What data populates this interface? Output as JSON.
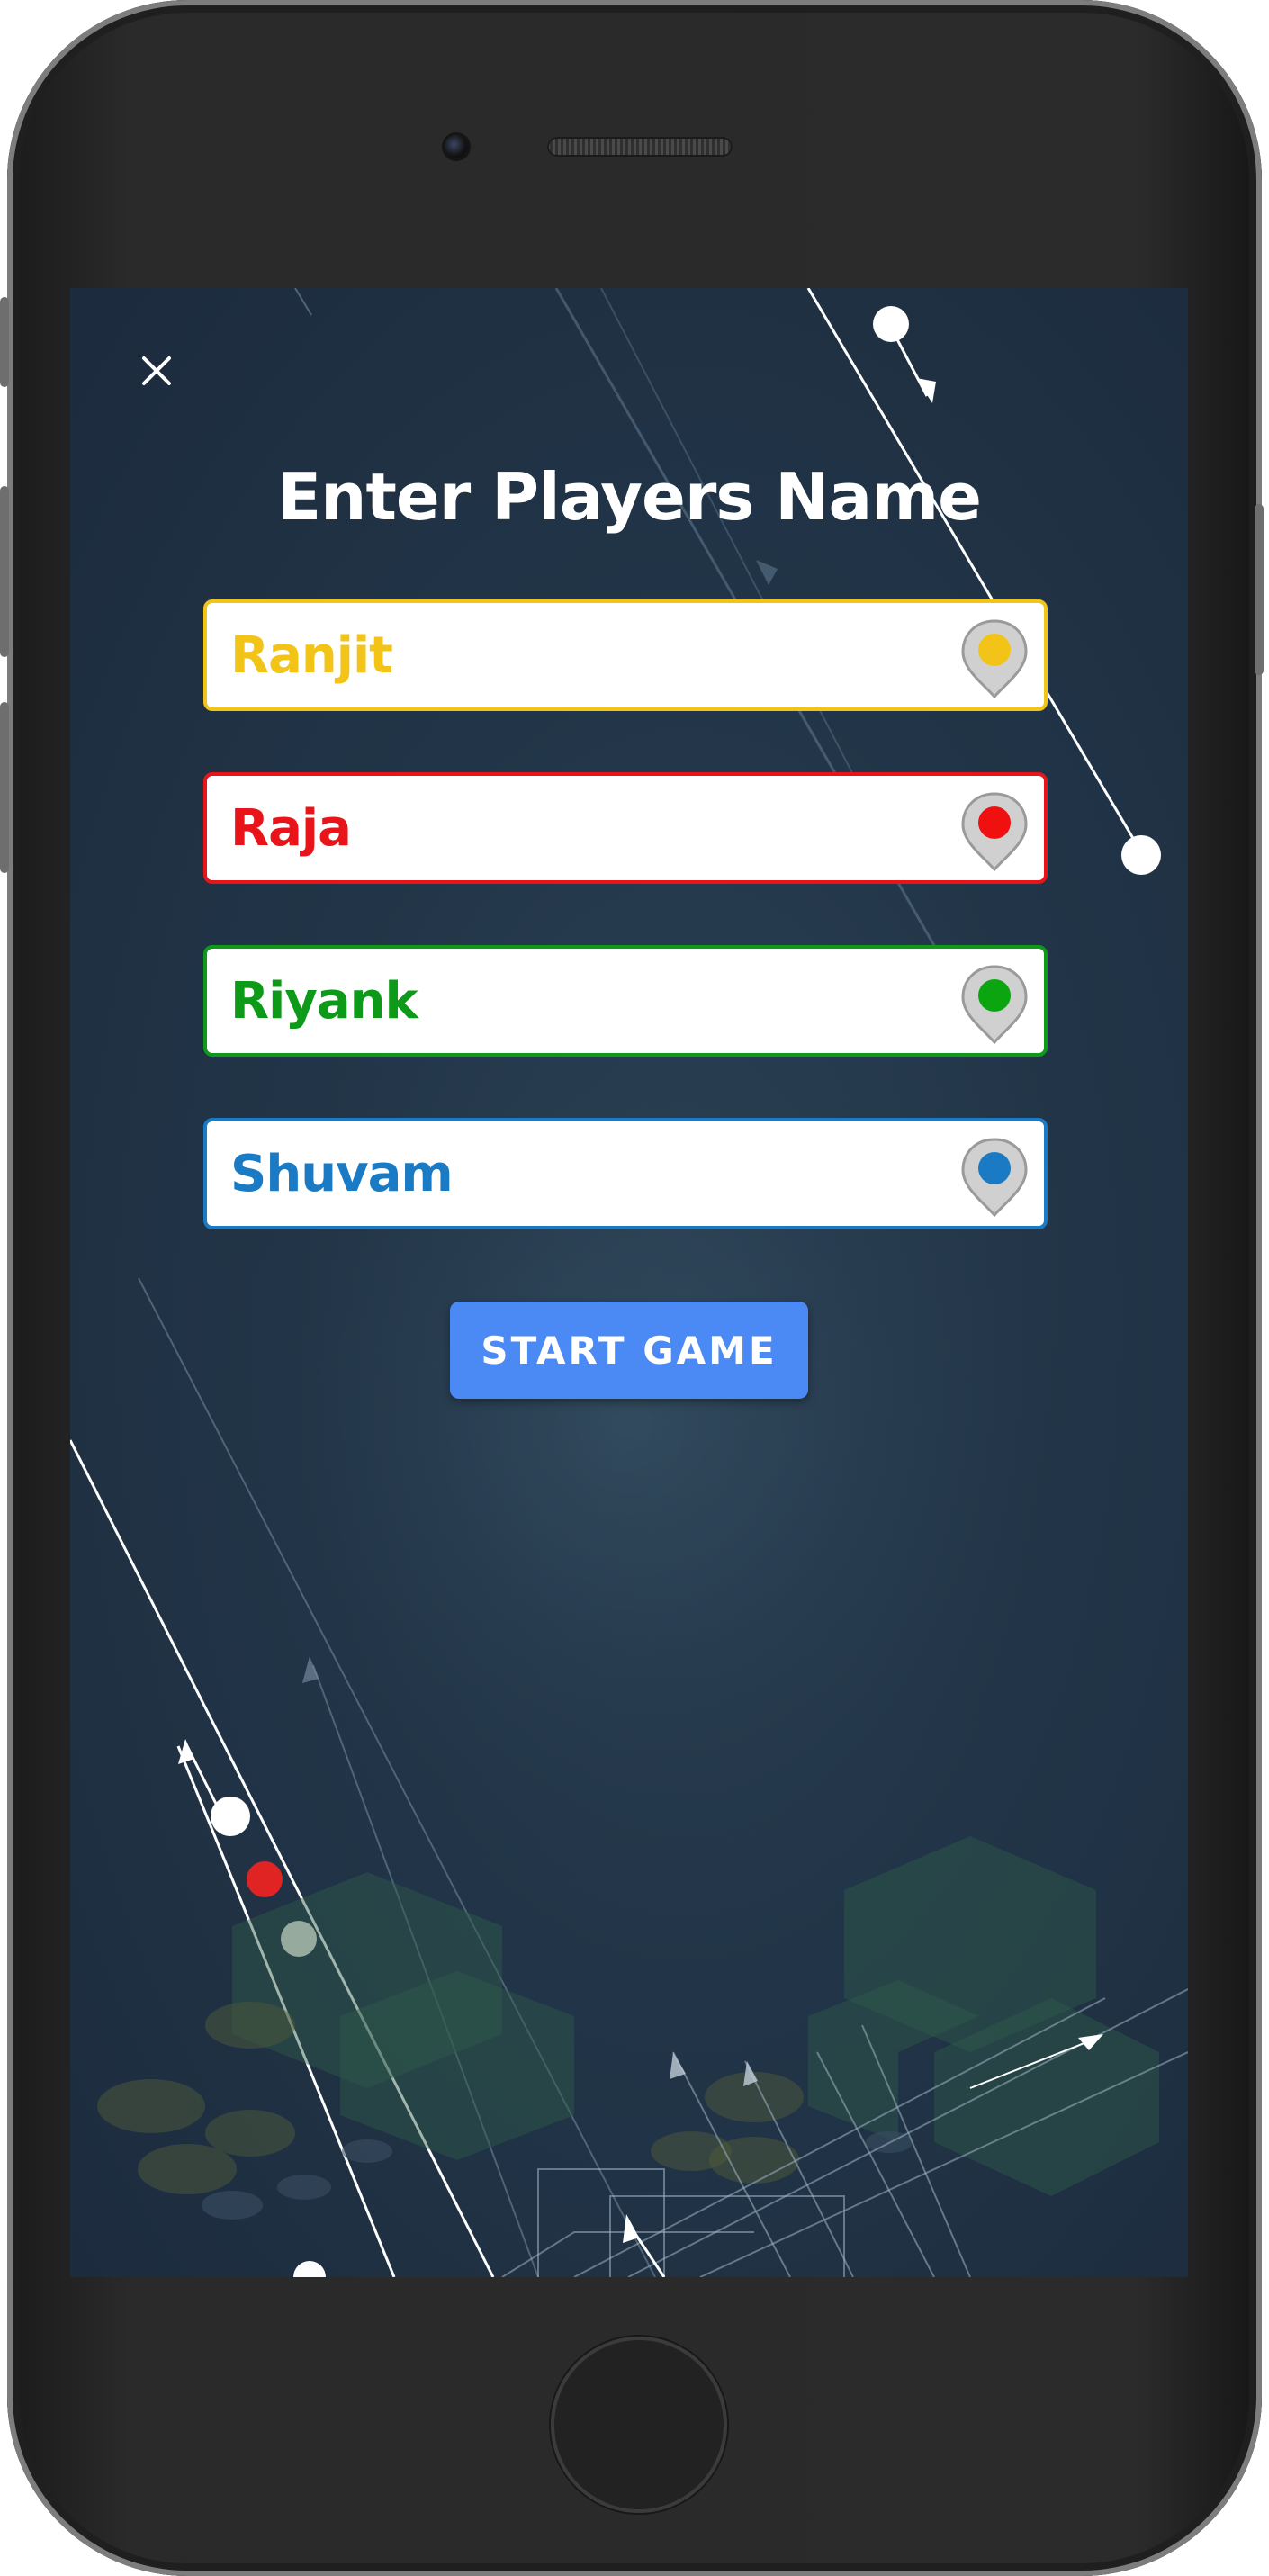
{
  "screen": {
    "title": "Enter Players Name",
    "close_icon": "close-icon",
    "start_label": "START GAME"
  },
  "players": [
    {
      "name": "Ranjit",
      "color": "#f2c418",
      "pin_color": "#f2c418"
    },
    {
      "name": "Raja",
      "color": "#e8141a",
      "pin_color": "#f01010"
    },
    {
      "name": "Riyank",
      "color": "#0d9a18",
      "pin_color": "#0aa50f"
    },
    {
      "name": "Shuvam",
      "color": "#1b7ac4",
      "pin_color": "#1b7ac4"
    }
  ],
  "colors": {
    "background": "#223548",
    "button": "#4b8af4",
    "text": "#ffffff"
  }
}
